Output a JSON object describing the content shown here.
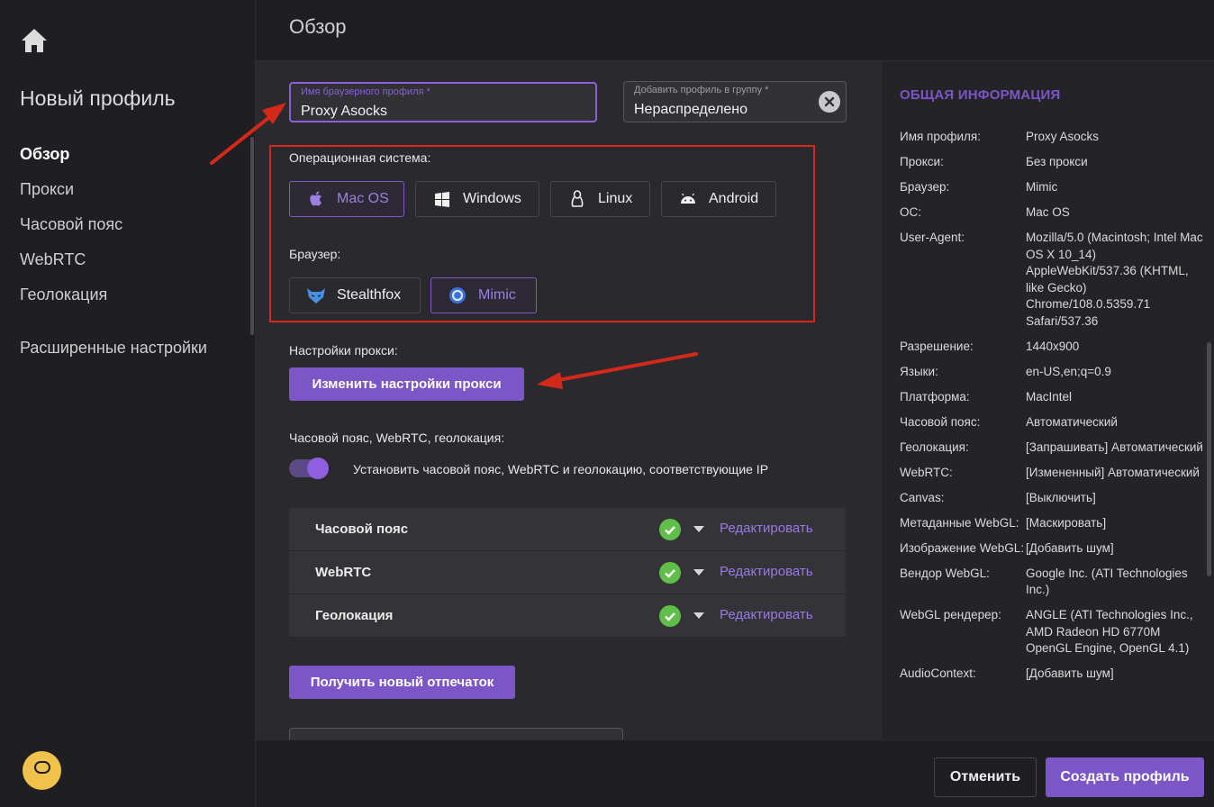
{
  "sidebar": {
    "title": "Новый профиль",
    "items": [
      {
        "label": "Обзор",
        "active": true
      },
      {
        "label": "Прокси"
      },
      {
        "label": "Часовой пояс"
      },
      {
        "label": "WebRTC"
      },
      {
        "label": "Геолокация"
      }
    ],
    "advanced": "Расширенные настройки"
  },
  "header": {
    "title": "Обзор"
  },
  "form": {
    "profile_name": {
      "label": "Имя браузерного профиля *",
      "value": "Proxy Asocks"
    },
    "group": {
      "label": "Добавить профиль в группу *",
      "value": "Нераспределено"
    },
    "os_label": "Операционная система:",
    "os_options": [
      "Mac OS",
      "Windows",
      "Linux",
      "Android"
    ],
    "os_selected": "Mac OS",
    "browser_label": "Браузер:",
    "browser_options": [
      "Stealthfox",
      "Mimic"
    ],
    "browser_selected": "Mimic",
    "proxy_label": "Настройки прокси:",
    "proxy_button": "Изменить настройки прокси",
    "tz_section_label": "Часовой пояс, WebRTC, геолокация:",
    "toggle_text": "Установить часовой пояс, WebRTC и геолокацию, соответствующие IP",
    "toggle_on": true,
    "rows": [
      {
        "label": "Часовой пояс",
        "edit": "Редактировать"
      },
      {
        "label": "WebRTC",
        "edit": "Редактировать"
      },
      {
        "label": "Геолокация",
        "edit": "Редактировать"
      }
    ],
    "fingerprint_button": "Получить новый отпечаток"
  },
  "info": {
    "title": "ОБЩАЯ ИНФОРМАЦИЯ",
    "rows": [
      {
        "k": "Имя профиля:",
        "v": "Proxy Asocks"
      },
      {
        "k": "Прокси:",
        "v": "Без прокси"
      },
      {
        "k": "Браузер:",
        "v": "Mimic"
      },
      {
        "k": "ОС:",
        "v": "Mac OS"
      },
      {
        "k": "User-Agent:",
        "v": "Mozilla/5.0 (Macintosh; Intel Mac OS X 10_14) AppleWebKit/537.36 (KHTML, like Gecko) Chrome/108.0.5359.71 Safari/537.36"
      },
      {
        "k": "Разрешение:",
        "v": "1440x900"
      },
      {
        "k": "Языки:",
        "v": "en-US,en;q=0.9"
      },
      {
        "k": "Платформа:",
        "v": "MacIntel"
      },
      {
        "k": "Часовой пояс:",
        "v": "Автоматический"
      },
      {
        "k": "Геолокация:",
        "v": "[Запрашивать] Автоматический"
      },
      {
        "k": "WebRTC:",
        "v": "[Измененный] Автоматический"
      },
      {
        "k": "Canvas:",
        "v": "[Выключить]"
      },
      {
        "k": "Метаданные WebGL:",
        "v": "[Маскировать]"
      },
      {
        "k": "Изображение WebGL:",
        "v": "[Добавить шум]"
      },
      {
        "k": "Вендор WebGL:",
        "v": "Google Inc. (ATI Technologies Inc.)"
      },
      {
        "k": "WebGL рендерер:",
        "v": "ANGLE (ATI Technologies Inc., AMD Radeon HD 6770M OpenGL Engine, OpenGL 4.1)"
      },
      {
        "k": "AudioContext:",
        "v": "[Добавить шум]"
      }
    ]
  },
  "footer": {
    "cancel": "Отменить",
    "create": "Создать профиль"
  },
  "colors": {
    "accent": "#7c55c6",
    "annotation": "#d4281b",
    "success": "#5fbf4a",
    "chat": "#f0c24b"
  },
  "icons": [
    "home-icon",
    "chat-icon",
    "apple-icon",
    "windows-icon",
    "linux-icon",
    "android-icon",
    "stealthfox-icon",
    "mimic-icon",
    "clear-icon",
    "check-icon",
    "chevron-down-icon"
  ]
}
